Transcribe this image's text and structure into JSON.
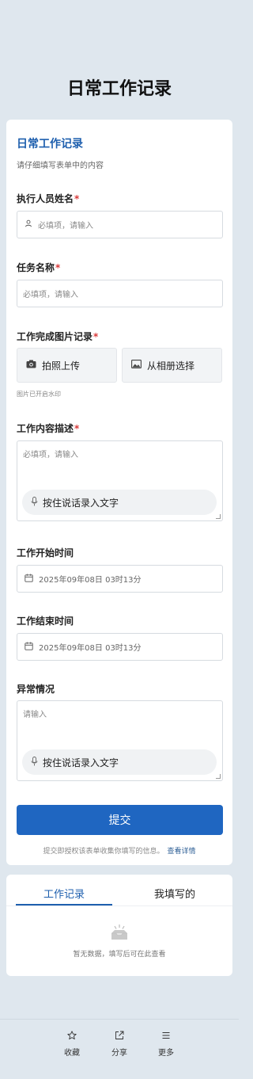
{
  "page": {
    "title": "日常工作记录"
  },
  "form": {
    "title": "日常工作记录",
    "description": "请仔细填写表单中的内容",
    "fields": {
      "name": {
        "label": "执行人员姓名",
        "required_mark": "*",
        "placeholder": "必填项，请输入",
        "icon": "person-icon"
      },
      "task": {
        "label": "任务名称",
        "required_mark": "*",
        "placeholder": "必填项，请输入"
      },
      "photo": {
        "label": "工作完成图片记录",
        "required_mark": "*",
        "camera_label": "拍照上传",
        "album_label": "从相册选择",
        "hint": "图片已开启水印"
      },
      "content": {
        "label": "工作内容描述",
        "required_mark": "*",
        "placeholder": "必填项，请输入",
        "voice_label": "按住说话录入文字"
      },
      "start_time": {
        "label": "工作开始时间",
        "value": "2025年09年08日 03时13分"
      },
      "end_time": {
        "label": "工作结束时间",
        "value": "2025年09年08日 03时13分"
      },
      "exception": {
        "label": "异常情况",
        "placeholder": "请输入",
        "voice_label": "按住说话录入文字"
      }
    },
    "submit_label": "提交",
    "consent_text": "提交即授权该表单收集你填写的信息。",
    "consent_link": "查看详情"
  },
  "records": {
    "tabs": [
      {
        "label": "工作记录",
        "active": true
      },
      {
        "label": "我填写的",
        "active": false
      }
    ],
    "empty_text": "暂无数据，填写后可在此查看"
  },
  "bottom_bar": [
    {
      "label": "收藏",
      "icon": "star-icon"
    },
    {
      "label": "分享",
      "icon": "share-icon"
    },
    {
      "label": "更多",
      "icon": "menu-icon"
    }
  ],
  "colors": {
    "accent": "#1f66c1",
    "required": "#d93a3a",
    "background": "#dfe7ee"
  }
}
